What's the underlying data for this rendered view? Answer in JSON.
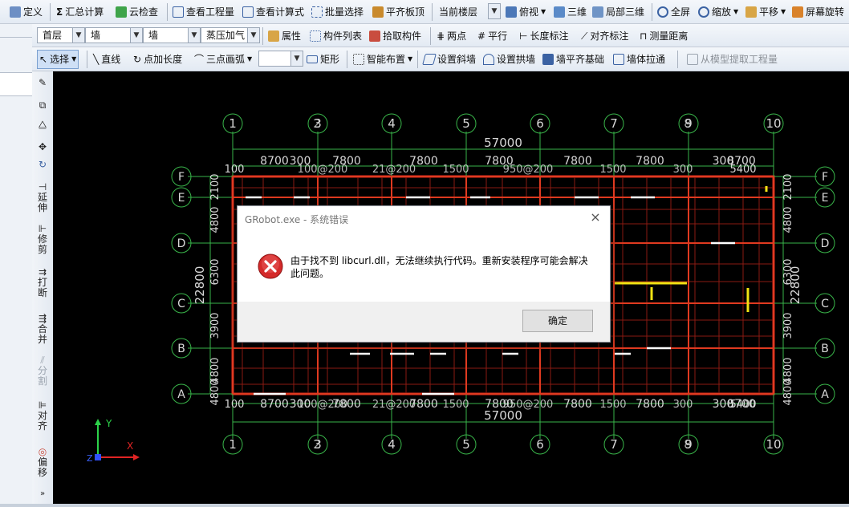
{
  "toolbar1": {
    "items": [
      {
        "label": "定义",
        "icon": "define-icon"
      },
      {
        "label": "汇总计算",
        "icon": "sigma-icon"
      },
      {
        "label": "云检查",
        "icon": "cloud-check-icon"
      },
      {
        "label": "查看工程量",
        "icon": "view-quantity-icon"
      },
      {
        "label": "查看计算式",
        "icon": "view-formula-icon"
      },
      {
        "label": "批量选择",
        "icon": "batch-select-icon"
      },
      {
        "label": "平齐板顶",
        "icon": "align-slab-icon"
      },
      {
        "label": "当前楼层",
        "icon": ""
      },
      {
        "label": "俯视",
        "icon": "top-view-icon"
      },
      {
        "label": "三维",
        "icon": "3d-icon"
      },
      {
        "label": "局部三维",
        "icon": "partial-3d-icon"
      },
      {
        "label": "全屏",
        "icon": "fullscreen-icon"
      },
      {
        "label": "缩放",
        "icon": "zoom-icon"
      },
      {
        "label": "平移",
        "icon": "pan-icon"
      },
      {
        "label": "屏幕旋转",
        "icon": "rotate-screen-icon"
      }
    ]
  },
  "toolbar2": {
    "floor": "首层",
    "category": "墙",
    "type": "墙",
    "material": "蒸压加气",
    "items": [
      {
        "label": "属性",
        "icon": "properties-icon"
      },
      {
        "label": "构件列表",
        "icon": "component-list-icon"
      },
      {
        "label": "拾取构件",
        "icon": "pick-component-icon"
      },
      {
        "label": "两点",
        "icon": "two-point-icon"
      },
      {
        "label": "平行",
        "icon": "parallel-icon"
      },
      {
        "label": "长度标注",
        "icon": "length-dim-icon"
      },
      {
        "label": "对齐标注",
        "icon": "align-dim-icon"
      },
      {
        "label": "测量距离",
        "icon": "measure-icon"
      }
    ]
  },
  "toolbar3": {
    "items": [
      {
        "label": "选择",
        "icon": "cursor-icon"
      },
      {
        "label": "直线",
        "icon": "line-icon"
      },
      {
        "label": "点加长度",
        "icon": "point-length-icon"
      },
      {
        "label": "三点画弧",
        "icon": "arc-icon"
      },
      {
        "label": "矩形",
        "icon": "rectangle-icon"
      },
      {
        "label": "智能布置",
        "icon": "smart-layout-icon"
      },
      {
        "label": "设置斜墙",
        "icon": "slant-wall-icon"
      },
      {
        "label": "设置拱墙",
        "icon": "arch-wall-icon"
      },
      {
        "label": "墙平齐基础",
        "icon": "wall-align-icon"
      },
      {
        "label": "墙体拉通",
        "icon": "wall-extend-icon"
      },
      {
        "label": "从模型提取工程量",
        "icon": "extract-icon"
      }
    ]
  },
  "vtoolbar": {
    "items": [
      "延伸",
      "修剪",
      "打断",
      "合并",
      "分割",
      "对齐",
      "偏移"
    ]
  },
  "drawing": {
    "top_cols": [
      "1",
      "3",
      "4",
      "5",
      "6",
      "7",
      "9",
      "10"
    ],
    "top_cols_overlap": [
      "2",
      "8"
    ],
    "rows": [
      "F",
      "E",
      "D",
      "C",
      "B",
      "A"
    ],
    "total_width": "57000",
    "total_height": "22800",
    "spans": [
      "8700",
      "300",
      "7800",
      "7800",
      "7800",
      "7800",
      "7800",
      "300",
      "8700"
    ],
    "left_dims": [
      "2100",
      "4800",
      "6300",
      "3900",
      "4800",
      "4800"
    ],
    "edge_dims": [
      "100",
      "100",
      "100",
      "5400"
    ],
    "overlay_texts": [
      "100@200",
      "21@200",
      "1500",
      "950@200",
      "1500",
      "300"
    ],
    "axis_x": "X",
    "axis_y": "Y",
    "axis_z": "Z"
  },
  "dialog": {
    "title": "GRobot.exe - 系统错误",
    "message": "由于找不到 libcurl.dll，无法继续执行代码。重新安装程序可能会解决此问题。",
    "ok": "确定",
    "close": "×"
  }
}
